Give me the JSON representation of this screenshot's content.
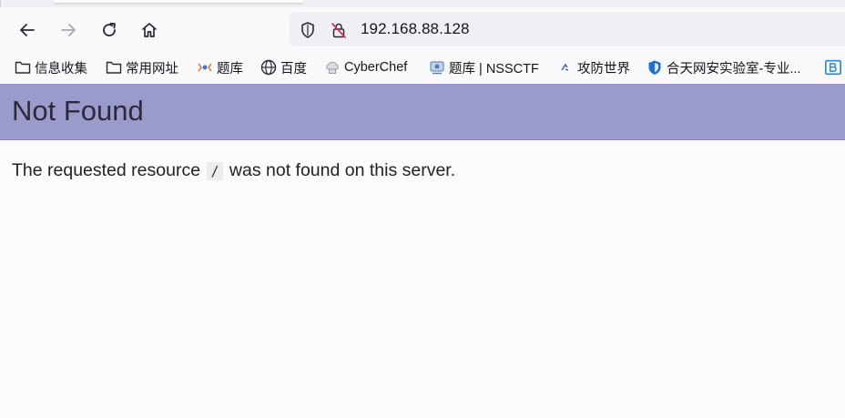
{
  "browser": {
    "url": "192.168.88.128",
    "nav": {
      "back": "arrow-left-icon",
      "forward": "arrow-right-icon",
      "reload": "reload-icon",
      "home": "home-icon"
    },
    "bookmarks": [
      {
        "label": "信息收集",
        "icon": "folder-icon"
      },
      {
        "label": "常用网址",
        "icon": "folder-icon"
      },
      {
        "label": "题库",
        "icon": "site-favicon"
      },
      {
        "label": "百度",
        "icon": "globe-icon"
      },
      {
        "label": "CyberChef",
        "icon": "chef-hat-icon"
      },
      {
        "label": "题库 | NSSCTF",
        "icon": "nssctf-favicon"
      },
      {
        "label": "攻防世界",
        "icon": "site-favicon"
      },
      {
        "label": "合天网安实验室-专业...",
        "icon": "shield-favicon"
      }
    ]
  },
  "page": {
    "title": "Not Found",
    "message_before": "The requested resource",
    "path": "/",
    "message_after": "was not found on this server."
  },
  "colors": {
    "banner": "#9a9acc",
    "background": "#fbfbfb"
  }
}
